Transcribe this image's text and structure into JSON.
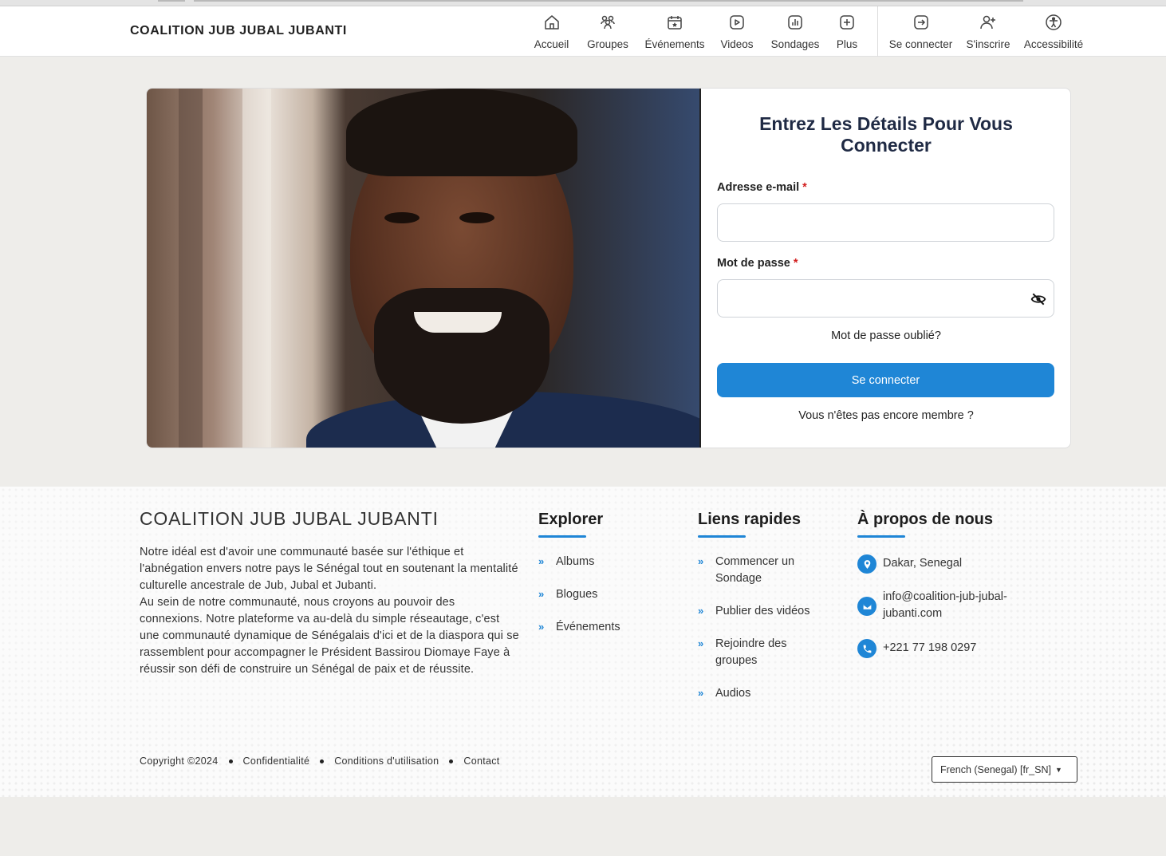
{
  "header": {
    "brand": "COALITION JUB JUBAL JUBANTI",
    "nav": [
      {
        "label": "Accueil",
        "icon": "home-icon"
      },
      {
        "label": "Groupes",
        "icon": "users-icon"
      },
      {
        "label": "Événements",
        "icon": "calendar-star-icon"
      },
      {
        "label": "Videos",
        "icon": "play-icon"
      },
      {
        "label": "Sondages",
        "icon": "bar-chart-icon"
      },
      {
        "label": "Plus",
        "icon": "plus-square-icon"
      }
    ],
    "nav_right": [
      {
        "label": "Se connecter",
        "icon": "login-icon"
      },
      {
        "label": "S'inscrire",
        "icon": "user-plus-icon"
      },
      {
        "label": "Accessibilité",
        "icon": "accessibility-icon"
      }
    ]
  },
  "login": {
    "title": "Entrez Les Détails Pour Vous Connecter",
    "email_label": "Adresse e-mail",
    "password_label": "Mot de passe",
    "required_mark": "*",
    "email_value": "",
    "password_value": "",
    "forgot": "Mot de passe oublié?",
    "submit": "Se connecter",
    "signup": "Vous n'êtes pas encore membre ?",
    "accent": "#1f86d6"
  },
  "footer": {
    "brand": "COALITION JUB JUBAL JUBANTI",
    "about_p1": "Notre idéal est d'avoir une communauté basée sur l'éthique et l'abnégation envers notre pays le Sénégal tout en soutenant la mentalité culturelle ancestrale de Jub, Jubal et Jubanti.",
    "about_p2": "Au sein de notre communauté, nous croyons au pouvoir des connexions. Notre plateforme va au-delà du simple réseautage, c'est une communauté dynamique de Sénégalais d'ici et de la diaspora qui se rassemblent pour accompagner le Président Bassirou Diomaye Faye à réussir son défi de construire un Sénégal de paix et de réussite.",
    "explorer": {
      "title": "Explorer",
      "links": [
        "Albums",
        "Blogues",
        "Événements"
      ]
    },
    "quick": {
      "title": "Liens rapides",
      "links": [
        "Commencer un Sondage",
        "Publier des vidéos",
        "Rejoindre des groupes",
        "Audios"
      ]
    },
    "about_us": {
      "title": "À propos de nous",
      "location": "Dakar, Senegal",
      "email": "info@coalition-jub-jubal-jubanti.com",
      "phone": "+221 77 198 0297"
    },
    "copyright": "Copyright ©2024",
    "bottom_links": [
      "Confidentialité",
      "Conditions d'utilisation",
      "Contact"
    ],
    "language": "French (Senegal) [fr_SN]"
  }
}
